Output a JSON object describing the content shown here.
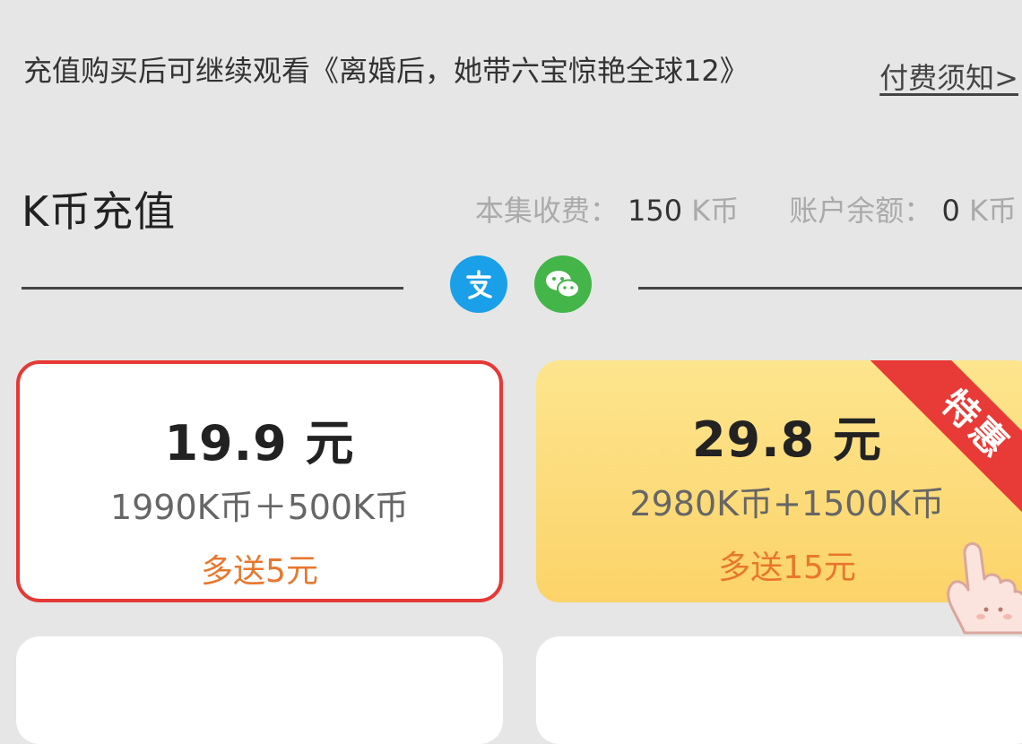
{
  "notice": {
    "text": "充值购买后可继续观看《离婚后，她带六宝惊艳全球12》",
    "terms_link": "付费须知>"
  },
  "recharge": {
    "title": "K币充值",
    "episode_fee_label": "本集收费：",
    "episode_fee_value": "150",
    "balance_label": "账户余额：",
    "balance_value": "0",
    "currency_unit": "K币"
  },
  "payment_methods": [
    {
      "name": "alipay-icon",
      "color": "#1aa0e8"
    },
    {
      "name": "wechat-pay-icon",
      "color": "#44b549"
    }
  ],
  "packages": [
    {
      "price": "19.9 元",
      "coins": "1990K币＋500K币",
      "bonus": "多送5元",
      "selected": true
    },
    {
      "price": "29.8 元",
      "coins": "2980K币+1500K币",
      "bonus": "多送15元",
      "badge": "特惠"
    }
  ],
  "colors": {
    "selected_border": "#e53935",
    "bonus_text": "#e8772e",
    "featured_card": "#fcd369",
    "badge": "#e83a36"
  }
}
